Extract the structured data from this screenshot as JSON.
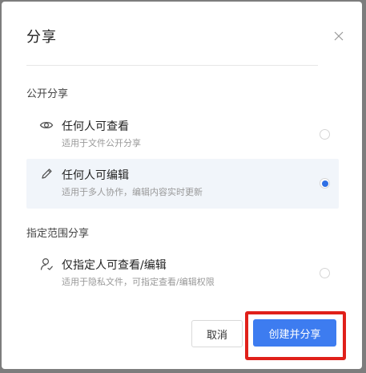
{
  "dialog": {
    "title": "分享",
    "close_icon": "close-icon"
  },
  "sections": [
    {
      "label": "公开分享",
      "options": [
        {
          "icon": "eye-icon",
          "title": "任何人可查看",
          "description": "适用于文件公开分享",
          "selected": false
        },
        {
          "icon": "pencil-icon",
          "title": "任何人可编辑",
          "description": "适用于多人协作，编辑内容实时更新",
          "selected": true
        }
      ]
    },
    {
      "label": "指定范围分享",
      "options": [
        {
          "icon": "user-icon",
          "title": "仅指定人可查看/编辑",
          "description": "适用于隐私文件，可指定查看/编辑权限",
          "selected": false
        }
      ]
    }
  ],
  "buttons": {
    "cancel_label": "取消",
    "create_label": "创建并分享"
  },
  "colors": {
    "accent": "#3d7cf0",
    "highlight": "#e0201a",
    "selected_bg": "#f1f5fa"
  }
}
